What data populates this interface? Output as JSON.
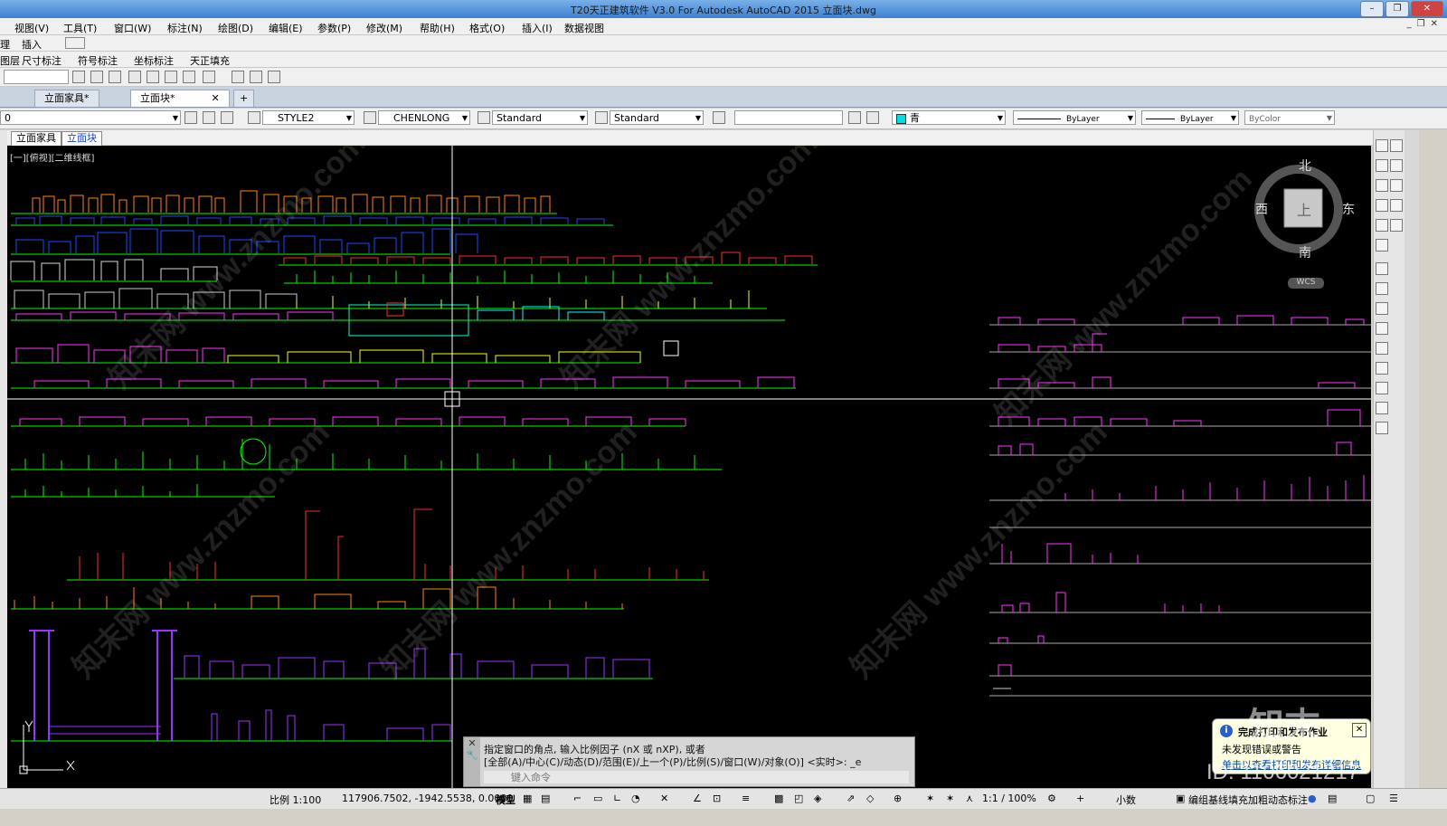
{
  "window": {
    "title": "T20天正建筑软件 V3.0 For Autodesk AutoCAD 2015     立面块.dwg",
    "buttons": [
      "–",
      "❐",
      "✕"
    ]
  },
  "menu": [
    "视图(V)",
    "工具(T)",
    "窗口(W)",
    "标注(N)",
    "绘图(D)",
    "编辑(E)",
    "参数(P)",
    "修改(M)",
    "帮助(H)",
    "格式(O)",
    "插入(I)",
    "数据视图"
  ],
  "ribbon": {
    "row2": [
      "理",
      "插入"
    ],
    "row3": [
      "图层",
      "尺寸标注",
      "符号标注",
      "坐标标注",
      "天正填充"
    ]
  },
  "doc_tabs": [
    "立面家具*",
    "立面块*"
  ],
  "properties": {
    "layer": "0",
    "text_style": "STYLE2",
    "dim_style": "CHENLONG",
    "table_style": "Standard",
    "mleader_style": "Standard",
    "color": "青",
    "linetype": "ByLayer",
    "lineweight": "ByLayer",
    "plotstyle": "ByColor"
  },
  "layout_tabs": [
    "立面家具",
    "立面块"
  ],
  "viewport_label": "[一][俯视][二维线框]",
  "viewcube": {
    "north": "北",
    "south": "南",
    "east": "东",
    "west": "西",
    "top": "上",
    "wcs": "WCS"
  },
  "command": {
    "line1": "指定窗口的角点, 输入比例因子 (nX 或 nXP), 或者",
    "line2": "[全部(A)/中心(C)/动态(D)/范围(E)/上一个(P)/比例(S)/窗口(W)/对象(O)] <实时>: _e",
    "placeholder": "键入命令"
  },
  "status": {
    "scale": "比例 1:100",
    "coords": "117906.7502, -1942.5538, 0.0000",
    "model": "模型",
    "anno_scale": "1:1 / 100%",
    "units": "小数",
    "tz_text": "编组基线填充加粗动态标注"
  },
  "balloon": {
    "title": "完成打印和发布作业",
    "body": "未发现错误或警告",
    "link": "单击以查看打印和发布详细信息"
  },
  "watermark": {
    "brand": "知末",
    "id": "ID: 1106021217",
    "site": "知末网 www.znzmo.com"
  }
}
